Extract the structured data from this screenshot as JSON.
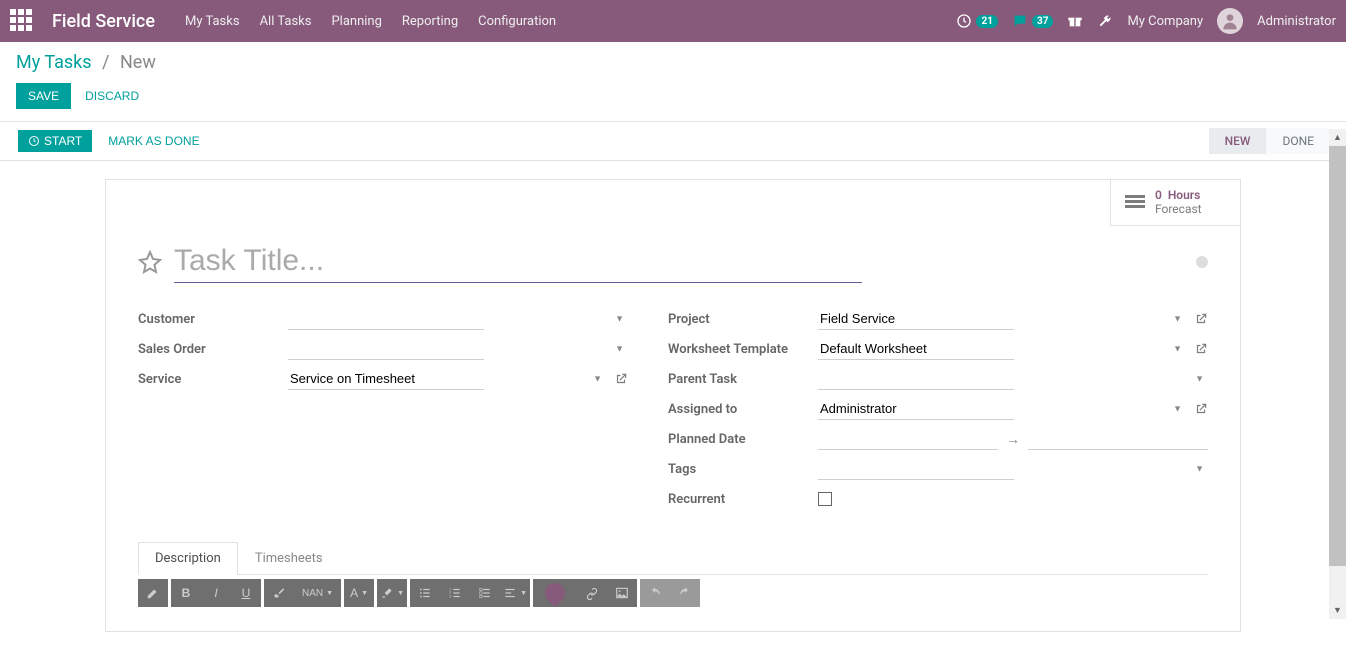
{
  "navbar": {
    "brand": "Field Service",
    "links": [
      "My Tasks",
      "All Tasks",
      "Planning",
      "Reporting",
      "Configuration"
    ],
    "clock_badge": "21",
    "chat_badge": "37",
    "company": "My Company",
    "user": "Administrator"
  },
  "breadcrumb": {
    "parent": "My Tasks",
    "current": "New"
  },
  "actions": {
    "save": "SAVE",
    "discard": "DISCARD",
    "start": "START",
    "mark_done": "MARK AS DONE"
  },
  "status": {
    "new": "NEW",
    "done": "DONE"
  },
  "stat": {
    "value": "0",
    "unit": "Hours",
    "label": "Forecast"
  },
  "title_placeholder": "Task Title...",
  "fields": {
    "customer_label": "Customer",
    "sales_order_label": "Sales Order",
    "service_label": "Service",
    "service_value": "Service on Timesheet",
    "project_label": "Project",
    "project_value": "Field Service",
    "worksheet_label": "Worksheet Template",
    "worksheet_value": "Default Worksheet",
    "parent_task_label": "Parent Task",
    "assigned_label": "Assigned to",
    "assigned_value": "Administrator",
    "planned_date_label": "Planned Date",
    "tags_label": "Tags",
    "recurrent_label": "Recurrent"
  },
  "tabs": {
    "description": "Description",
    "timesheets": "Timesheets"
  },
  "toolbar": {
    "nan": "NAN"
  }
}
